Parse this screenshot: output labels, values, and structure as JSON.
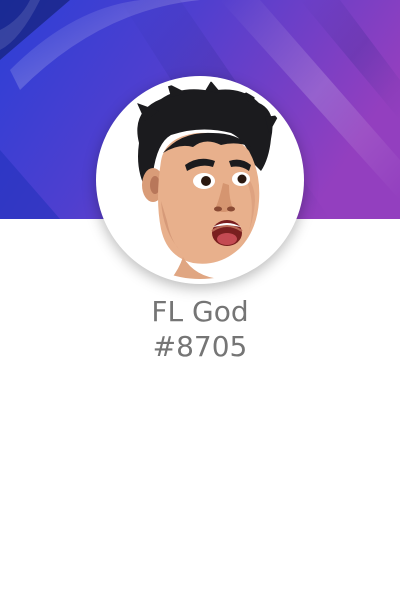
{
  "profile": {
    "username": "FL God",
    "discriminator": "#8705",
    "avatar_icon": "face-avatar-icon"
  },
  "colors": {
    "banner_start": "#2f43d8",
    "banner_end": "#8e3fbe",
    "text": "#757575",
    "background": "#ffffff"
  }
}
